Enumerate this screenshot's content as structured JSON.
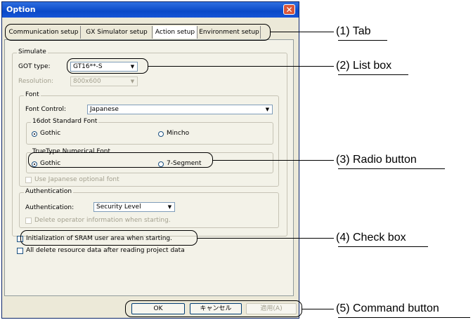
{
  "window": {
    "title": "Option",
    "close_symbol": "✕"
  },
  "tabs": [
    "Communication setup",
    "GX Simulator setup",
    "Action setup",
    "Environment setup"
  ],
  "simulate": {
    "group_label": "Simulate",
    "got_type_label": "GOT type:",
    "got_type_value": "GT16**-S",
    "resolution_label": "Resolution:",
    "resolution_value": "800x600"
  },
  "font": {
    "group_label": "Font",
    "font_control_label": "Font Control:",
    "font_control_value": "Japanese",
    "standard_group": "16dot Standard Font",
    "standard_options": [
      "Gothic",
      "Mincho"
    ],
    "truetype_group": "TrueType Numerical Font",
    "truetype_options": [
      "Gothic",
      "7-Segment"
    ],
    "japanese_optional": "Use Japanese optional font"
  },
  "authentication": {
    "group_label": "Authentication",
    "auth_label": "Authentication:",
    "auth_value": "Security Level",
    "delete_operator": "Delete operator information when starting."
  },
  "checkboxes": {
    "init_sram": "Initialization of SRAM user area when starting.",
    "delete_resource": "All delete resource data after reading project data"
  },
  "buttons": {
    "ok": "OK",
    "cancel": "キャンセル",
    "apply": "適用(A)"
  },
  "annotations": {
    "tab": "(1) Tab",
    "list_box": "(2) List box",
    "radio_button": "(3) Radio button",
    "check_box": "(4) Check box",
    "command_button": "(5) Command button"
  }
}
